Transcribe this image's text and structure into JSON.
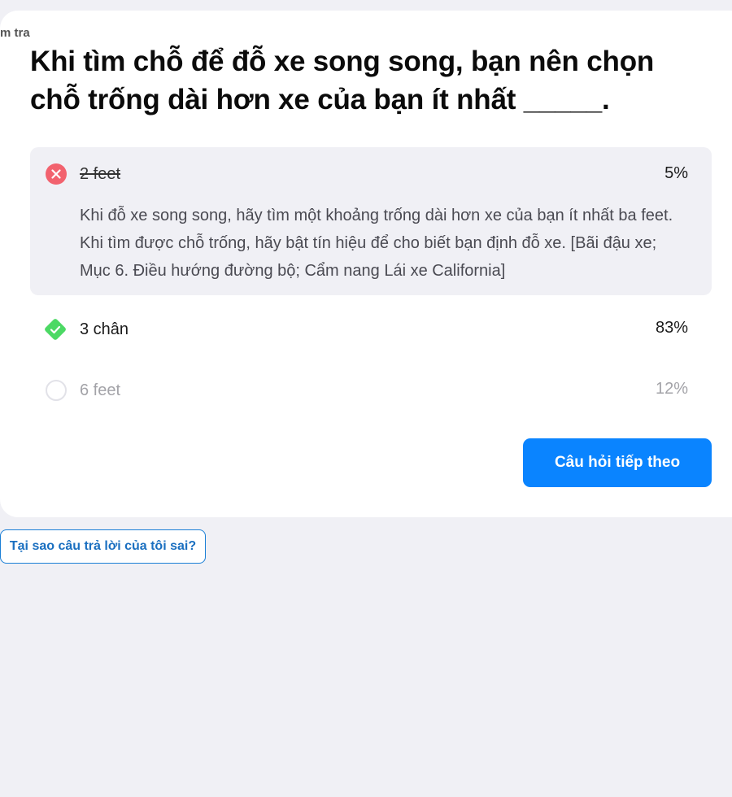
{
  "category": {
    "label": "m tra"
  },
  "question": {
    "text": "Khi tìm chỗ để đỗ xe song song, bạn nên chọn chỗ trống dài hơn xe của bạn ít nhất _____."
  },
  "options": [
    {
      "label": "2 feet",
      "percent": "5%",
      "state": "wrong-selected",
      "icon": "x-circle-icon",
      "explanation": "Khi đỗ xe song song, hãy tìm một khoảng trống dài hơn xe của bạn ít nhất ba feet. Khi tìm được chỗ trống, hãy bật tín hiệu để cho biết bạn định đỗ xe. [Bãi đậu xe; Mục 6. Điều hướng đường bộ; Cẩm nang Lái xe California]"
    },
    {
      "label": "3 chân",
      "percent": "83%",
      "state": "correct",
      "icon": "check-diamond-icon"
    },
    {
      "label": "6 feet",
      "percent": "12%",
      "state": "unselected",
      "icon": "empty-circle-icon"
    }
  ],
  "actions": {
    "next_label": "Câu hỏi tiếp theo",
    "why_wrong_label": "Tại sao câu trả lời của tôi sai?"
  },
  "colors": {
    "wrong": "#f2626e",
    "correct": "#4cd964",
    "accent": "#0a84ff",
    "background": "#f0f0f5"
  }
}
